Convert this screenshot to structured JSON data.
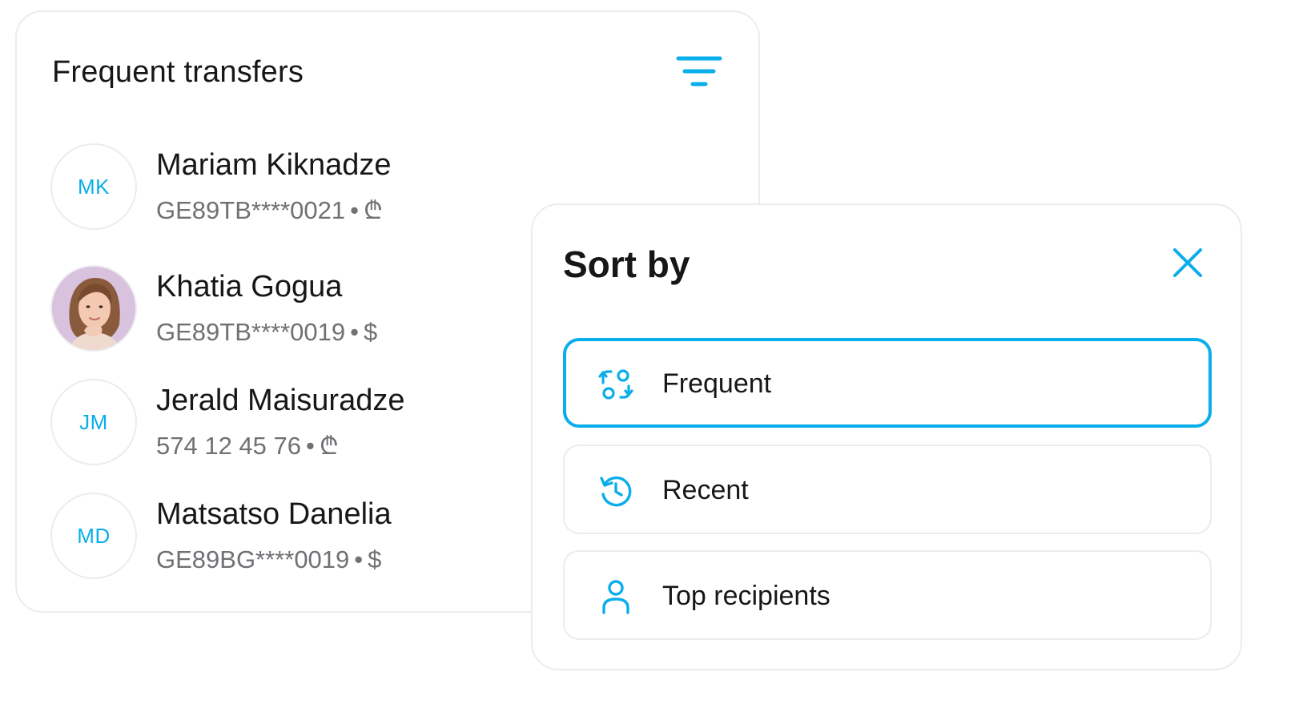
{
  "accent_color": "#0aaeea",
  "transfers": {
    "title": "Frequent transfers",
    "filter_icon": "filter-icon",
    "recipients": [
      {
        "initials": "MK",
        "name": "Mariam Kiknadze",
        "account": "GE89TB****0021",
        "currency": "₾",
        "avatar": "initials"
      },
      {
        "initials": "",
        "name": "Khatia Gogua",
        "account": "GE89TB****0019",
        "currency": "$",
        "avatar": "photo"
      },
      {
        "initials": "JM",
        "name": "Jerald Maisuradze",
        "account": "574 12 45 76",
        "currency": "₾",
        "avatar": "initials"
      },
      {
        "initials": "MD",
        "name": "Matsatso Danelia",
        "account": "GE89BG****0019",
        "currency": "$",
        "avatar": "initials"
      }
    ],
    "separator": "•"
  },
  "sort": {
    "title": "Sort by",
    "close_icon": "close-icon",
    "options": [
      {
        "label": "Frequent",
        "icon": "swap-icon",
        "selected": true
      },
      {
        "label": "Recent",
        "icon": "history-icon",
        "selected": false
      },
      {
        "label": "Top recipients",
        "icon": "person-icon",
        "selected": false
      }
    ]
  }
}
